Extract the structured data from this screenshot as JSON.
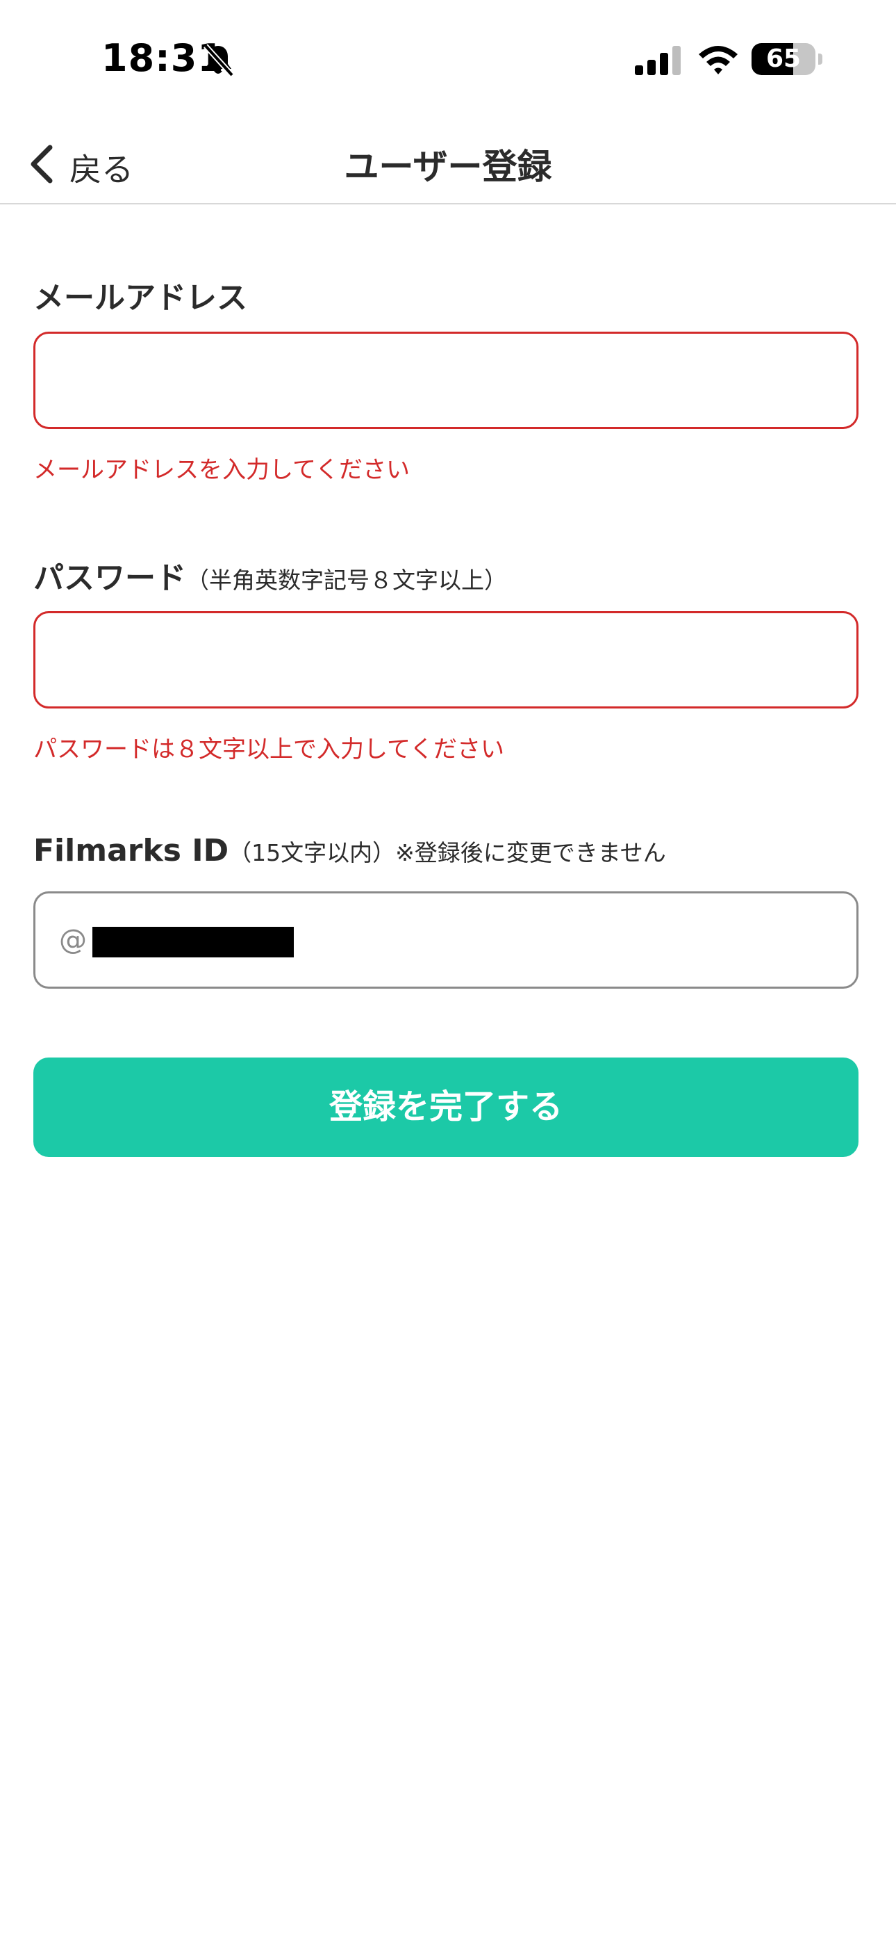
{
  "status_bar": {
    "time": "18:31",
    "battery_level": "65",
    "battery_percent": 65,
    "icons": [
      "bell-slash-icon",
      "cellular-signal-icon",
      "wifi-icon",
      "battery-icon"
    ]
  },
  "nav": {
    "back_label": "戻る",
    "title": "ユーザー登録"
  },
  "form": {
    "email": {
      "label": "メールアドレス",
      "value": "",
      "error": "メールアドレスを入力してください"
    },
    "password": {
      "label": "パスワード",
      "note": "（半角英数字記号８文字以上）",
      "value": "",
      "error": "パスワードは８文字以上で入力してください"
    },
    "filmarks_id": {
      "label": "Filmarks ID",
      "note": "（15文字以内）※登録後に変更できません",
      "prefix": "@"
    },
    "submit_label": "登録を完了する"
  },
  "colors": {
    "accent": "#1cc9a7",
    "error": "#d32a2a",
    "text": "#2b2b2b"
  }
}
